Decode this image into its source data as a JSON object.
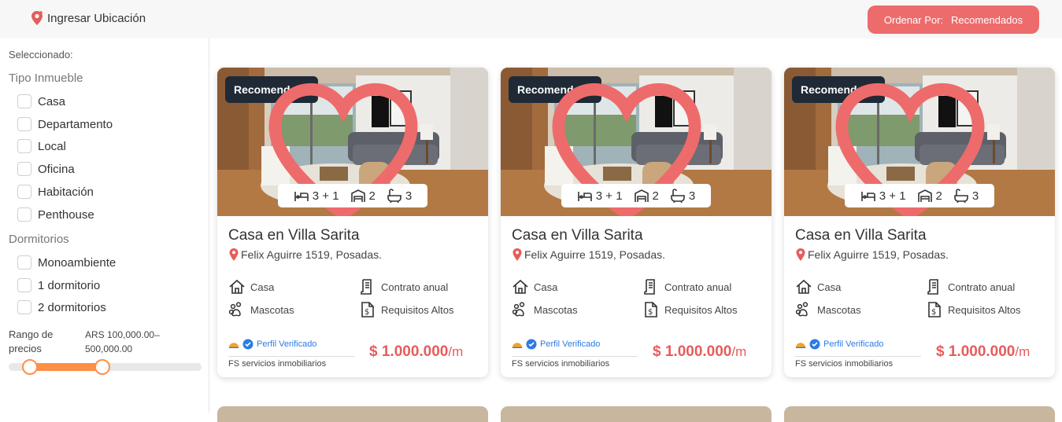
{
  "header": {
    "location_label": "Ingresar Ubicación",
    "order_label": "Ordenar Por:",
    "order_value": "Recomendados"
  },
  "sidebar": {
    "selected_label": "Seleccionado:",
    "property_type_title": "Tipo Inmueble",
    "property_types": [
      "Casa",
      "Departamento",
      "Local",
      "Oficina",
      "Habitación",
      "Penthouse"
    ],
    "bedrooms_title": "Dormitorios",
    "bedrooms": [
      "Monoambiente",
      "1 dormitorio",
      "2 dormitorios"
    ],
    "price_range_label": "Rango de precios",
    "price_range_value": "ARS 100,000.00–500,000.00",
    "price_range_slider": {
      "min_fraction": 0.11,
      "max_fraction": 0.485
    }
  },
  "listings": [
    {
      "badge": "Recomendado",
      "beds": "3 + 1",
      "garage": "2",
      "baths": "3",
      "title": "Casa en Villa Sarita",
      "address": "Felix Aguirre 1519, Posadas.",
      "type": "Casa",
      "contract": "Contrato anual",
      "pets": "Mascotas",
      "requirements": "Requisitos Altos",
      "verified": "Perfil Verificado",
      "agency": "FS servicios inmobiliarios",
      "price": "$ 1.000.000",
      "price_unit": "/m"
    },
    {
      "badge": "Recomendado",
      "beds": "3 + 1",
      "garage": "2",
      "baths": "3",
      "title": "Casa en Villa Sarita",
      "address": "Felix Aguirre 1519, Posadas.",
      "type": "Casa",
      "contract": "Contrato anual",
      "pets": "Mascotas",
      "requirements": "Requisitos Altos",
      "verified": "Perfil Verificado",
      "agency": "FS servicios inmobiliarios",
      "price": "$ 1.000.000",
      "price_unit": "/m"
    },
    {
      "badge": "Recomendado",
      "beds": "3 + 1",
      "garage": "2",
      "baths": "3",
      "title": "Casa en Villa Sarita",
      "address": "Felix Aguirre 1519, Posadas.",
      "type": "Casa",
      "contract": "Contrato anual",
      "pets": "Mascotas",
      "requirements": "Requisitos Altos",
      "verified": "Perfil Verificado",
      "agency": "FS servicios inmobiliarios",
      "price": "$ 1.000.000",
      "price_unit": "/m"
    }
  ],
  "colors": {
    "accent": "#ee6b6b",
    "price": "#e65c5c",
    "slider": "#ff8f45",
    "badge_bg": "#1f2a36",
    "verified": "#2c7be5"
  }
}
